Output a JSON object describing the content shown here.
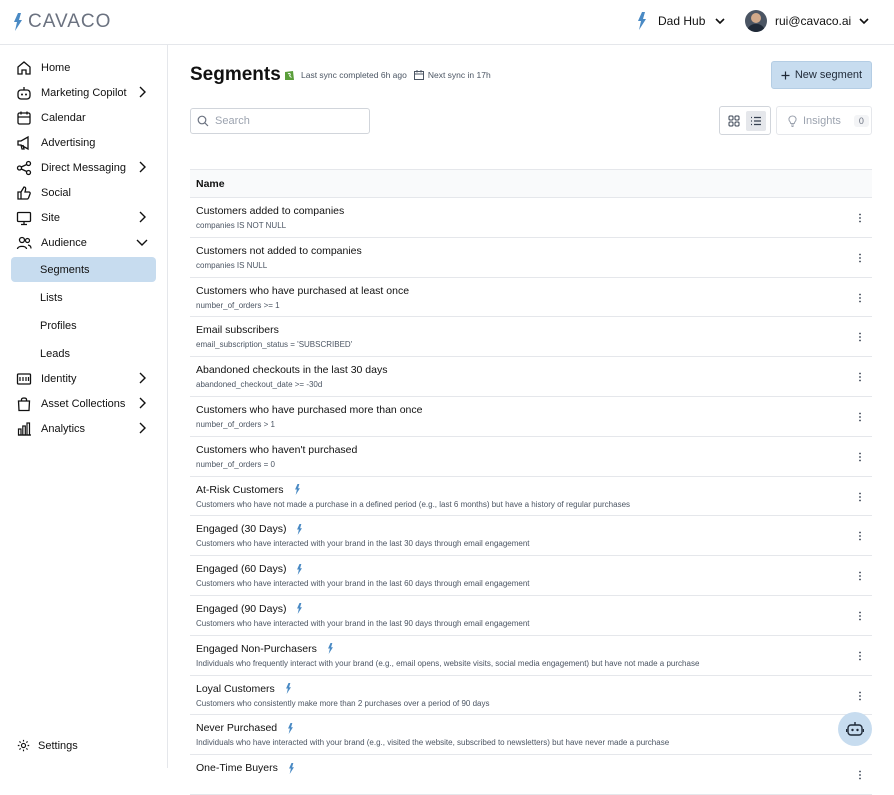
{
  "app": {
    "logo_text": "CAVACO"
  },
  "header": {
    "hub_name": "Dad Hub",
    "user_email": "rui@cavaco.ai"
  },
  "sidebar": {
    "items": [
      {
        "label": "Home",
        "icon": "home-icon"
      },
      {
        "label": "Marketing Copilot",
        "icon": "robot-icon"
      },
      {
        "label": "Calendar",
        "icon": "calendar-icon"
      },
      {
        "label": "Advertising",
        "icon": "megaphone-icon"
      },
      {
        "label": "Direct Messaging",
        "icon": "share-icon"
      },
      {
        "label": "Social",
        "icon": "thumbs-up-icon"
      },
      {
        "label": "Site",
        "icon": "monitor-icon"
      },
      {
        "label": "Audience",
        "icon": "users-icon"
      },
      {
        "label": "Segments"
      },
      {
        "label": "Lists"
      },
      {
        "label": "Profiles"
      },
      {
        "label": "Leads"
      },
      {
        "label": "Identity",
        "icon": "id-card-icon"
      },
      {
        "label": "Asset Collections",
        "icon": "bag-icon"
      },
      {
        "label": "Analytics",
        "icon": "bar-chart-icon"
      }
    ],
    "settings_label": "Settings",
    "active_item": "Segments"
  },
  "page": {
    "title": "Segments",
    "last_sync": "Last sync completed 6h ago",
    "next_sync": "Next sync in 17h",
    "new_segment_label": "New segment",
    "search_placeholder": "Search",
    "insights_label": "Insights",
    "insights_count": "0"
  },
  "table": {
    "column_name": "Name",
    "rows": [
      {
        "name": "Customers added to companies",
        "desc": "companies IS NOT NULL",
        "ai": false
      },
      {
        "name": "Customers not added to companies",
        "desc": "companies IS NULL",
        "ai": false
      },
      {
        "name": "Customers who have purchased at least once",
        "desc": "number_of_orders >= 1",
        "ai": false
      },
      {
        "name": "Email subscribers",
        "desc": "email_subscription_status = 'SUBSCRIBED'",
        "ai": false
      },
      {
        "name": "Abandoned checkouts in the last 30 days",
        "desc": "abandoned_checkout_date >= -30d",
        "ai": false
      },
      {
        "name": "Customers who have purchased more than once",
        "desc": "number_of_orders > 1",
        "ai": false
      },
      {
        "name": "Customers who haven't purchased",
        "desc": "number_of_orders = 0",
        "ai": false
      },
      {
        "name": "At-Risk Customers",
        "desc": "Customers who have not made a purchase in a defined period (e.g., last 6 months) but have a history of regular purchases",
        "ai": true
      },
      {
        "name": "Engaged (30 Days)",
        "desc": "Customers who have interacted with your brand in the last 30 days through email engagement",
        "ai": true
      },
      {
        "name": "Engaged (60 Days)",
        "desc": "Customers who have interacted with your brand in the last 60 days through email engagement",
        "ai": true
      },
      {
        "name": "Engaged (90 Days)",
        "desc": "Customers who have interacted with your brand in the last 90 days through email engagement",
        "ai": true
      },
      {
        "name": "Engaged Non-Purchasers",
        "desc": "Individuals who frequently interact with your brand (e.g., email opens, website visits, social media engagement) but have not made a purchase",
        "ai": true
      },
      {
        "name": "Loyal Customers",
        "desc": "Customers who consistently make more than 2 purchases over a period of 90 days",
        "ai": true
      },
      {
        "name": "Never Purchased",
        "desc": "Individuals who have interacted with your brand (e.g., visited the website, subscribed to newsletters) but have never made a purchase",
        "ai": true
      },
      {
        "name": "One-Time Buyers",
        "desc": "",
        "ai": true
      }
    ]
  },
  "colors": {
    "accent": "#c7dcef",
    "brand_blue": "#3b82c4"
  }
}
